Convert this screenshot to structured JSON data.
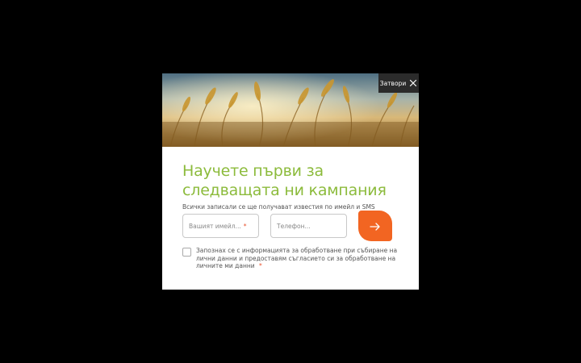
{
  "modal": {
    "close_label": "Затвори",
    "title": "Научете първи за следващата ни кампания",
    "subtitle": "Всички записали се ще получават известия по имейл и SMS",
    "email_placeholder": "Вашият имейл...",
    "phone_placeholder": "Телефон...",
    "required_mark": "*",
    "consent_text": "Запознах се с информацията за обработване при събиране на лични данни и предоставям съгласието си за обработване на личните ми данни",
    "consent_checked": false
  },
  "colors": {
    "title_green": "#8cbb3c",
    "submit_orange": "#f26522",
    "close_bg": "#2b2b2b",
    "overlay": "#000000"
  },
  "icons": {
    "close": "close-icon",
    "submit": "arrow-right-icon"
  }
}
